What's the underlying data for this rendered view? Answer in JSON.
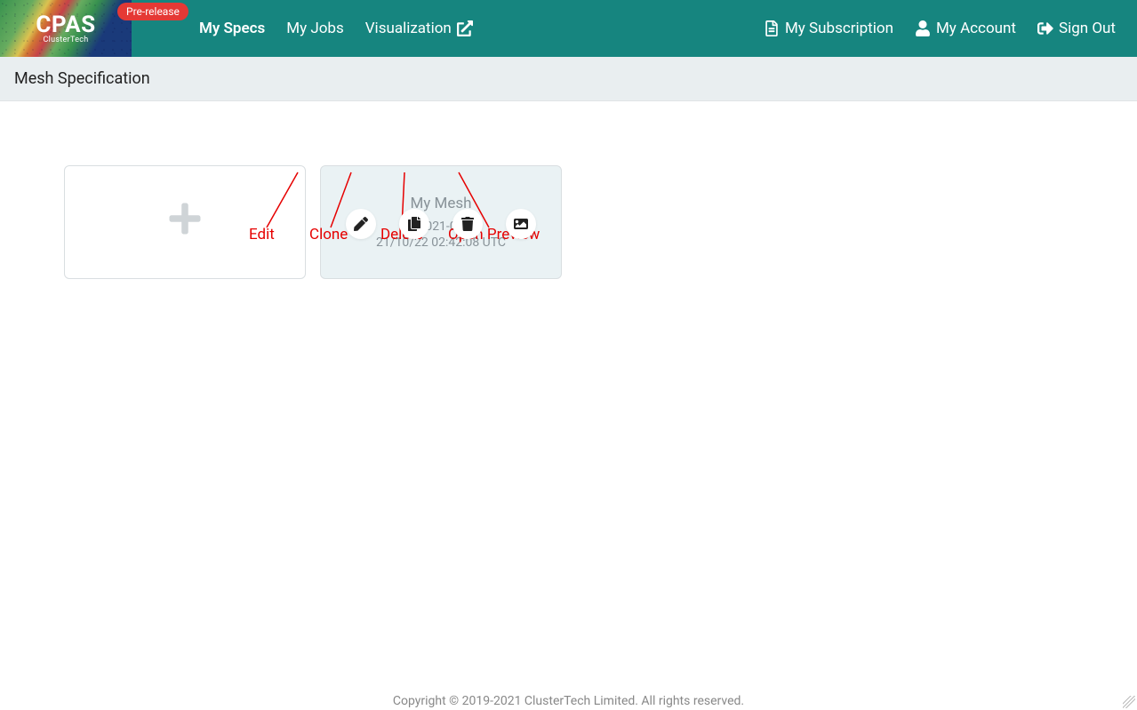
{
  "brand": {
    "name": "CPAS",
    "sub": "ClusterTech",
    "badge": "Pre-release"
  },
  "nav": {
    "my_specs": "My Specs",
    "my_jobs": "My Jobs",
    "visualization": "Visualization",
    "my_subscription": "My Subscription",
    "my_account": "My Account",
    "sign_out": "Sign Out"
  },
  "page_title": "Mesh Specification",
  "mesh_card": {
    "title": "My Mesh",
    "created": "2021-08",
    "timestamp": "21/10/22 02:42:08 UTC"
  },
  "annotations": {
    "edit": "Edit",
    "clone": "Clone",
    "delete": "Delete",
    "open_preview": "Open Preview"
  },
  "footer": "Copyright © 2019-2021 ClusterTech Limited. All rights reserved."
}
